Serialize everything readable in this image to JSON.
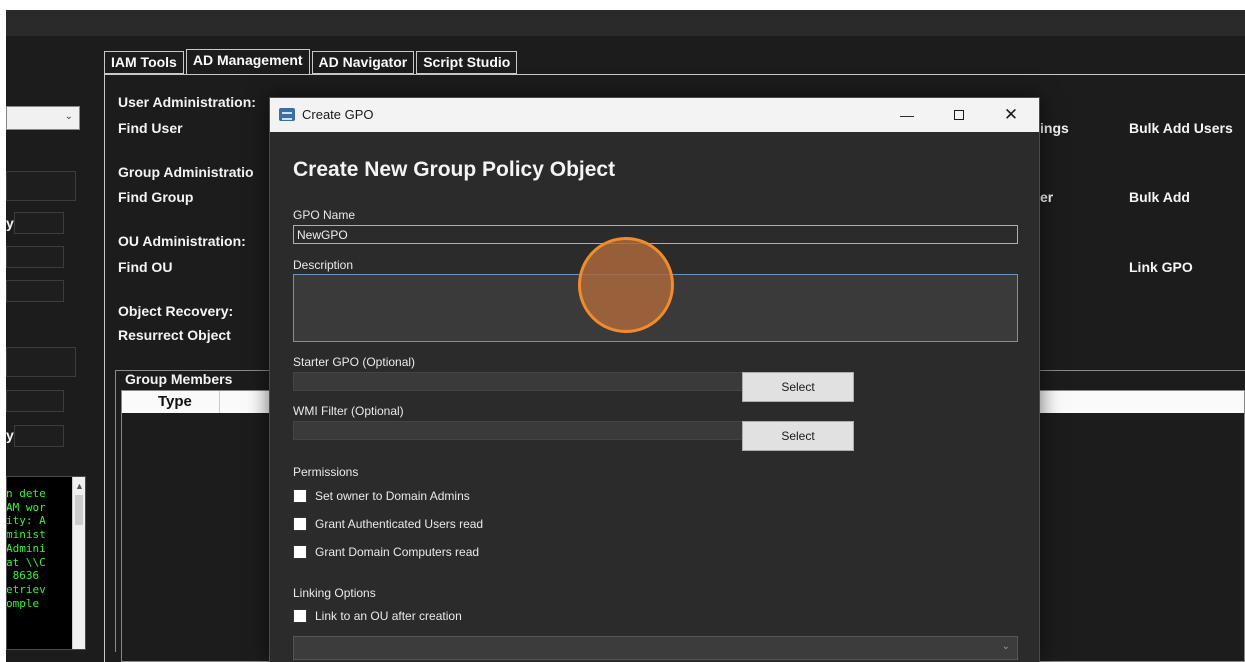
{
  "tabs": [
    {
      "label": "IAM Tools",
      "active": false
    },
    {
      "label": "AD Management",
      "active": true
    },
    {
      "label": "AD Navigator",
      "active": false
    },
    {
      "label": "Script Studio",
      "active": false
    }
  ],
  "sections": {
    "user_admin": "User Administration:",
    "find_user": "Find User",
    "group_admin": "Group Administratio",
    "find_group": "Find Group",
    "ou_admin": "OU Administration:",
    "find_ou": "Find OU",
    "object_recovery": "Object Recovery:",
    "resurrect_object": "Resurrect Object"
  },
  "right_actions": {
    "settings_partial": "ings",
    "bulk_add_users": "Bulk Add Users",
    "er_partial": "er",
    "bulk_add": "Bulk Add",
    "link_gpo": "Link GPO"
  },
  "left_panel": {
    "label_y1": "y",
    "label_y2": "y",
    "console_lines": [
      "n dete",
      "AM wor",
      "ity: A",
      "minist",
      "Admini",
      "at \\\\C",
      " 8636",
      "etriev",
      "omple"
    ]
  },
  "group_members": {
    "title": "Group Members",
    "column_type": "Type"
  },
  "dialog": {
    "title": "Create GPO",
    "heading": "Create New Group Policy Object",
    "gpo_name_label": "GPO Name",
    "gpo_name_value": "NewGPO",
    "description_label": "Description",
    "starter_gpo_label": "Starter GPO (Optional)",
    "wmi_filter_label": "WMI Filter (Optional)",
    "select_label": "Select",
    "permissions_label": "Permissions",
    "permissions": [
      {
        "label": "Set owner to Domain Admins",
        "checked": false
      },
      {
        "label": "Grant Authenticated Users read",
        "checked": false
      },
      {
        "label": "Grant Domain Computers read",
        "checked": false
      }
    ],
    "linking_label": "Linking Options",
    "link_ou_label": "Link to an OU after creation",
    "link_ou_checked": false
  },
  "colors": {
    "app_background": "#1c1c1c",
    "dialog_background": "#2b2b2b",
    "console_text": "#3cf03c",
    "touch_marker": "#f08c2a"
  }
}
